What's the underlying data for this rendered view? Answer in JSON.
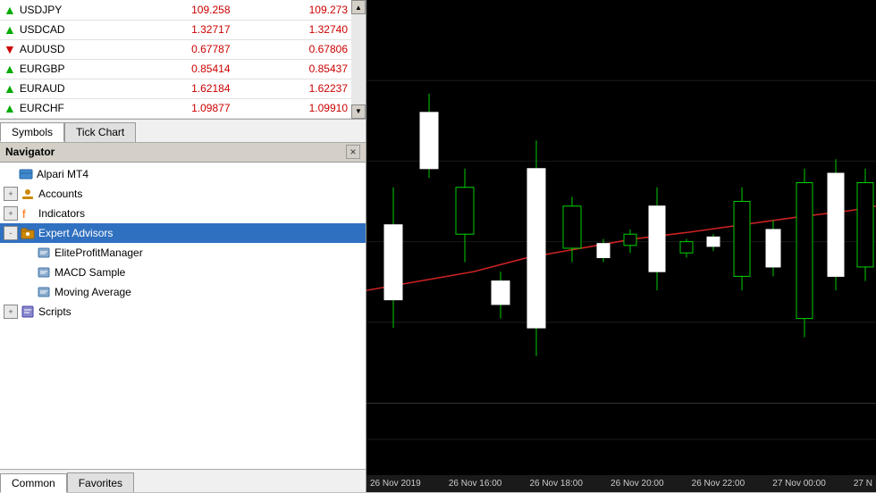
{
  "symbols": [
    {
      "name": "USDJPY",
      "bid": "109.258",
      "ask": "109.273",
      "bidColor": "red",
      "askColor": "red",
      "arrowColor": "green"
    },
    {
      "name": "USDCAD",
      "bid": "1.32717",
      "ask": "1.32740",
      "bidColor": "red",
      "askColor": "red",
      "arrowColor": "green"
    },
    {
      "name": "AUDUSD",
      "bid": "0.67787",
      "ask": "0.67806",
      "bidColor": "red",
      "askColor": "red",
      "arrowColor": "red"
    },
    {
      "name": "EURGBP",
      "bid": "0.85414",
      "ask": "0.85437",
      "bidColor": "red",
      "askColor": "red",
      "arrowColor": "green"
    },
    {
      "name": "EURAUD",
      "bid": "1.62184",
      "ask": "1.62237",
      "bidColor": "red",
      "askColor": "red",
      "arrowColor": "green"
    },
    {
      "name": "EURCHF",
      "bid": "1.09877",
      "ask": "1.09910",
      "bidColor": "red",
      "askColor": "red",
      "arrowColor": "green"
    }
  ],
  "tabs": {
    "symbols_label": "Symbols",
    "tickchart_label": "Tick Chart"
  },
  "navigator": {
    "title": "Navigator",
    "close_label": "×",
    "tree": [
      {
        "id": "alpari",
        "label": "Alpari MT4",
        "level": 0,
        "expand": null,
        "icon": "broker"
      },
      {
        "id": "accounts",
        "label": "Accounts",
        "level": 0,
        "expand": "+",
        "icon": "accounts"
      },
      {
        "id": "indicators",
        "label": "Indicators",
        "level": 0,
        "expand": "+",
        "icon": "indicators"
      },
      {
        "id": "expert-advisors",
        "label": "Expert Advisors",
        "level": 0,
        "expand": "-",
        "icon": "ea",
        "selected": true
      },
      {
        "id": "elite",
        "label": "EliteProfitManager",
        "level": 1,
        "expand": null,
        "icon": "ea-item"
      },
      {
        "id": "macd",
        "label": "MACD Sample",
        "level": 1,
        "expand": null,
        "icon": "ea-item"
      },
      {
        "id": "moving-avg",
        "label": "Moving Average",
        "level": 1,
        "expand": null,
        "icon": "ea-item"
      },
      {
        "id": "scripts",
        "label": "Scripts",
        "level": 0,
        "expand": "+",
        "icon": "scripts"
      }
    ]
  },
  "bottom_tabs": {
    "common_label": "Common",
    "favorites_label": "Favorites"
  },
  "time_labels": [
    "26 Nov 2019",
    "26 Nov 16:00",
    "26 Nov 18:00",
    "26 Nov 20:00",
    "26 Nov 22:00",
    "27 Nov 00:00",
    "27 N"
  ],
  "chart": {
    "accent_color": "#ffffff",
    "candle_bull": "#ffffff",
    "candle_bear": "#000000",
    "ma_line": "#cc0000"
  }
}
